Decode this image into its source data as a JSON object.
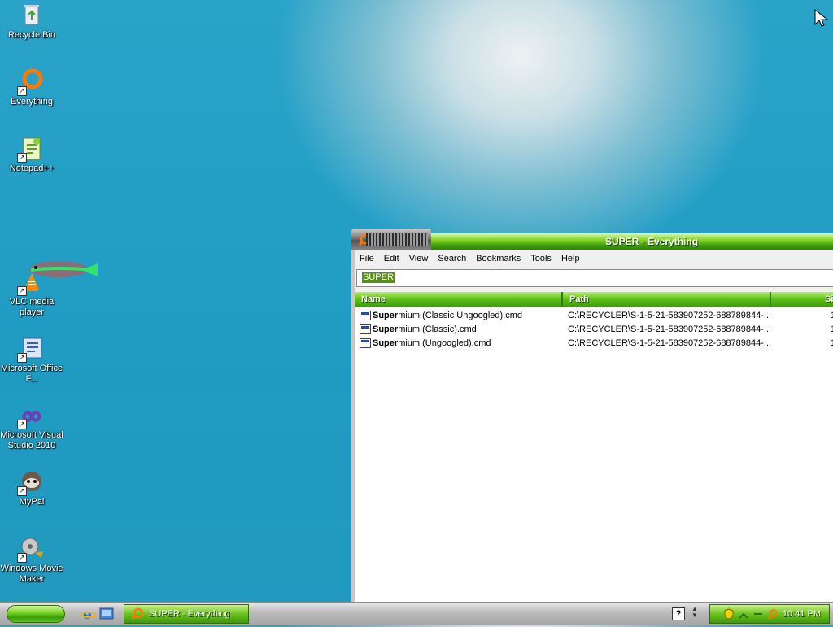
{
  "desktop": {
    "icons": [
      {
        "label": "Recycle Bin",
        "icon": "recycle-bin-icon"
      },
      {
        "label": "Everything",
        "icon": "everything-icon"
      },
      {
        "label": "Notepad++",
        "icon": "notepadpp-icon"
      },
      {
        "label": "VLC media player",
        "icon": "vlc-icon"
      },
      {
        "label": "Microsoft Office F...",
        "icon": "office-icon"
      },
      {
        "label": "Microsoft Visual Studio 2010",
        "icon": "visual-studio-icon"
      },
      {
        "label": "MyPal",
        "icon": "mypal-icon"
      },
      {
        "label": "Windows Movie Maker",
        "icon": "movie-maker-icon"
      }
    ]
  },
  "window": {
    "title": "SUPER - Everything",
    "menu": [
      "File",
      "Edit",
      "View",
      "Search",
      "Bookmarks",
      "Tools",
      "Help"
    ],
    "search_value": "SUPER",
    "columns": [
      "Name",
      "Path",
      "Si"
    ],
    "rows": [
      {
        "name_bold": "Super",
        "name_rest": "mium (Classic Ungoogled).cmd",
        "path": "C:\\RECYCLER\\S-1-5-21-583907252-688789844-...",
        "size": "1"
      },
      {
        "name_bold": "Super",
        "name_rest": "mium (Classic).cmd",
        "path": "C:\\RECYCLER\\S-1-5-21-583907252-688789844-...",
        "size": "1"
      },
      {
        "name_bold": "Super",
        "name_rest": "mium (Ungoogled).cmd",
        "path": "C:\\RECYCLER\\S-1-5-21-583907252-688789844-...",
        "size": "1"
      }
    ]
  },
  "taskbar": {
    "task_label": "SUPER - Everything",
    "help_glyph": "?",
    "clock": "10:41 PM"
  },
  "colors": {
    "accent_green": "#6cc21e",
    "desktop_blue": "#2aa3c9"
  }
}
